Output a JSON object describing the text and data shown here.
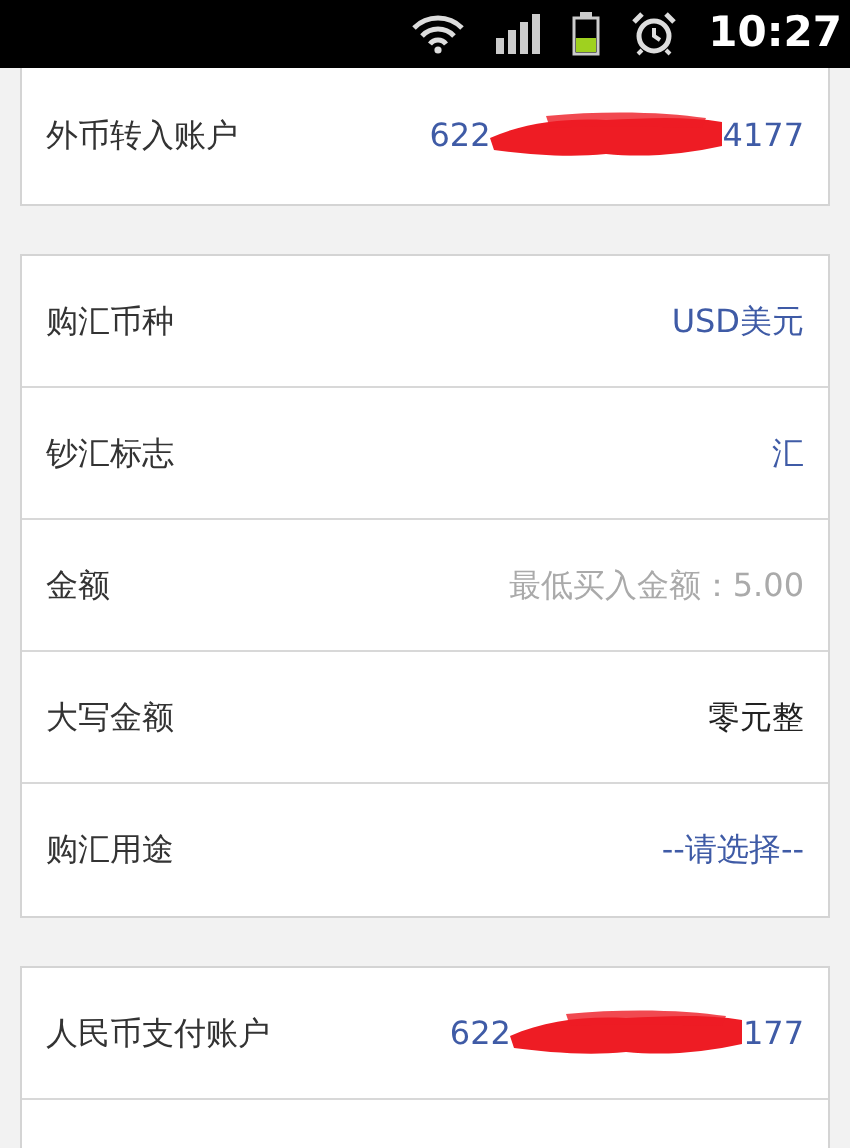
{
  "status_bar": {
    "time": "10:27"
  },
  "sections": [
    {
      "rows": [
        {
          "label": "外币转入账户",
          "kind": "account",
          "prefix": "622",
          "suffix": "4177",
          "redacted": true
        }
      ],
      "cut_top": true
    },
    {
      "rows": [
        {
          "label": "购汇币种",
          "kind": "link",
          "value": "USD美元"
        },
        {
          "label": "钞汇标志",
          "kind": "link",
          "value": "汇"
        },
        {
          "label": "金额",
          "kind": "input",
          "placeholder": "最低买入金额：5.00"
        },
        {
          "label": "大写金额",
          "kind": "text",
          "value": "零元整"
        },
        {
          "label": "购汇用途",
          "kind": "link",
          "value": "--请选择--"
        }
      ]
    },
    {
      "rows": [
        {
          "label": "人民币支付账户",
          "kind": "account",
          "prefix": "622",
          "suffix": "177",
          "redacted": true
        },
        {
          "kind": "empty"
        }
      ]
    }
  ]
}
